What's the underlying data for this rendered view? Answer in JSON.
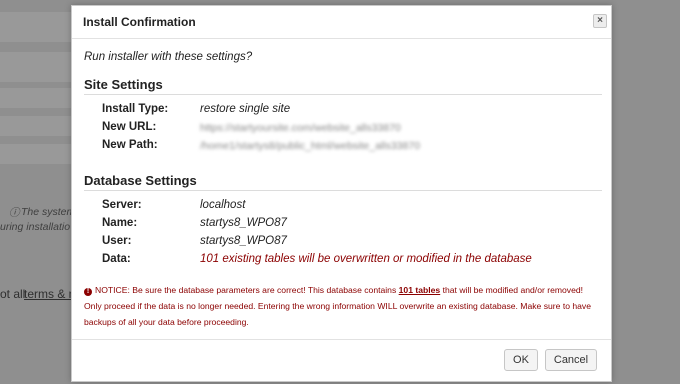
{
  "background": {
    "notice_text": "The system",
    "notice_text_2": "uring installatio",
    "terms_prefix": "ot all",
    "terms_link": "terms & n"
  },
  "dialog": {
    "title": "Install Confirmation",
    "close_icon": "close-icon",
    "intro": "Run installer with these settings?",
    "site_settings": {
      "heading": "Site Settings",
      "rows": [
        {
          "label": "Install Type:",
          "value": "restore single site"
        },
        {
          "label": "New URL:",
          "value": "https://startyoursite.com/website_alls33870"
        },
        {
          "label": "New Path:",
          "value": "/home1/startys8/public_html/website_alls33870"
        }
      ]
    },
    "database_settings": {
      "heading": "Database Settings",
      "rows": [
        {
          "label": "Server:",
          "value": "localhost"
        },
        {
          "label": "Name:",
          "value": "startys8_WPO87"
        },
        {
          "label": "User:",
          "value": "startys8_WPO87"
        },
        {
          "label": "Data:",
          "value": "101 existing tables will be overwritten or modified in the database"
        }
      ]
    },
    "notice": {
      "icon": "exclamation-icon",
      "part1": "NOTICE: Be sure the database parameters are correct! This database contains ",
      "highlight": "101 tables",
      "part2": " that will be modified and/or removed! Only proceed if the data is no longer needed. Entering the wrong information WILL overwrite an existing database. Make sure to have backups of all your data before proceeding.",
      "color": "#8b0000"
    },
    "buttons": {
      "ok": "OK",
      "cancel": "Cancel"
    }
  }
}
